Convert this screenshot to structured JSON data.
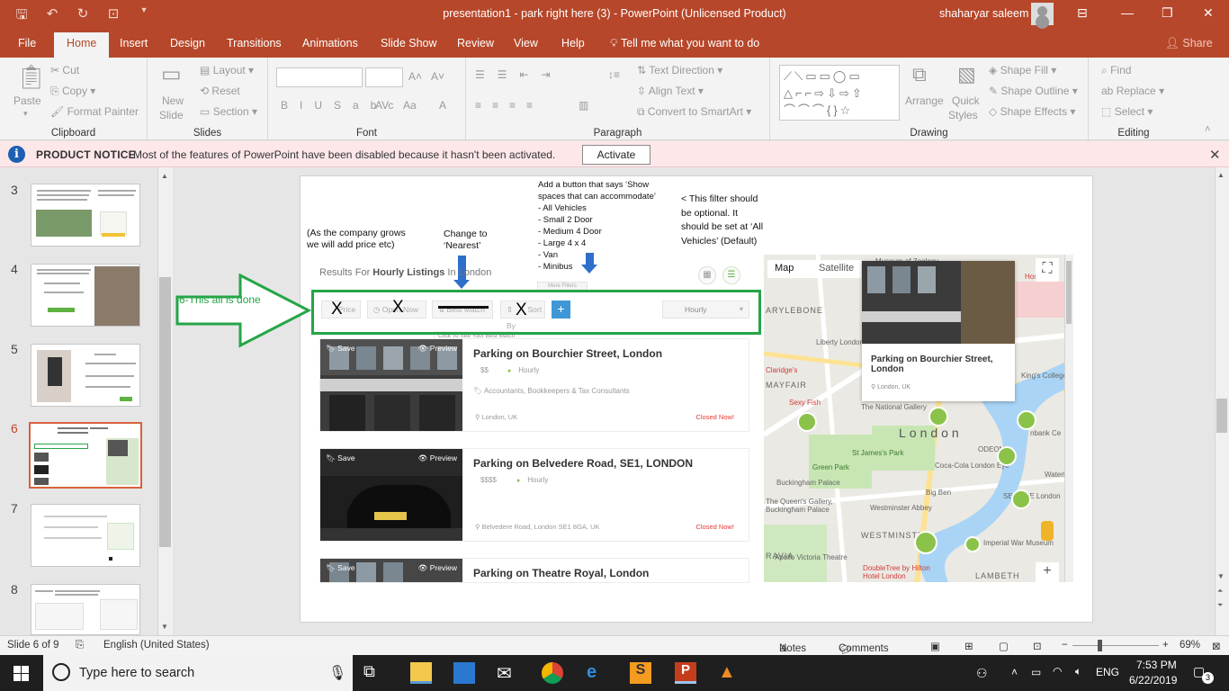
{
  "window": {
    "title": "presentation1 - park right here (3)  -  PowerPoint (Unlicensed Product)",
    "user": "shaharyar saleem"
  },
  "tabs": [
    "File",
    "Home",
    "Insert",
    "Design",
    "Transitions",
    "Animations",
    "Slide Show",
    "Review",
    "View",
    "Help"
  ],
  "tell_me": "Tell me what you want to do",
  "share": "Share",
  "ribbon": {
    "clipboard": {
      "label": "Clipboard",
      "paste": "Paste",
      "cut": "Cut",
      "copy": "Copy",
      "format_painter": "Format Painter"
    },
    "slides": {
      "label": "Slides",
      "new_slide_1": "New",
      "new_slide_2": "Slide",
      "layout": "Layout",
      "reset": "Reset",
      "section": "Section"
    },
    "font": {
      "label": "Font"
    },
    "paragraph": {
      "label": "Paragraph",
      "text_direction": "Text Direction",
      "align_text": "Align Text",
      "convert": "Convert to SmartArt"
    },
    "drawing": {
      "label": "Drawing",
      "arrange": "Arrange",
      "quick_1": "Quick",
      "quick_2": "Styles",
      "fill": "Shape Fill",
      "outline": "Shape Outline",
      "effects": "Shape Effects"
    },
    "editing": {
      "label": "Editing",
      "find": "Find",
      "replace": "Replace",
      "select": "Select"
    }
  },
  "notice": {
    "title": "PRODUCT NOTICE",
    "text": "Most of the features of PowerPoint have been disabled because it hasn't been activated.",
    "button": "Activate"
  },
  "thumbnails": {
    "numbers": [
      "3",
      "4",
      "5",
      "6",
      "7",
      "8"
    ],
    "selected": "6"
  },
  "slide": {
    "note_price": "(As the company grows\nwe will add price etc)",
    "note_nearest": "Change to\n‘Nearest’",
    "note_button": "Add a button that says ‘Show\nspaces that can accommodate’\n- All Vehicles\n- Small 2 Door\n- Medium 4 Door\n- Large 4 x 4\n- Van\n- Minibus",
    "note_optional": "< This filter should\nbe optional. It\nshould be set at ‘All\nVehicles’ (Default)",
    "done_label": "6-This all is done",
    "results_prefix": "Results For ",
    "results_bold": "Hourly Listings",
    "results_suffix": " In London",
    "filters": {
      "price": "Price",
      "open_now": "Open Now",
      "best_match": "Best Match",
      "sort_by": "Sort By",
      "more_filters": "More Filters",
      "match_tip": "Click To See Your Best Match",
      "hourly": "Hourly",
      "x": "X"
    },
    "listings": [
      {
        "title": "Parking on Bourchier Street, London",
        "price": "$$",
        "type": "Hourly",
        "category": "Accountants, Bookkeepers & Tax Consultants",
        "address": "London, UK",
        "status": "Closed Now!"
      },
      {
        "title": "Parking on Belvedere Road, SE1, LONDON",
        "price": "$$$$",
        "type": "Hourly",
        "category": "",
        "address": "Belvedere Road, London SE1 8GA, UK",
        "status": "Closed Now!"
      },
      {
        "title": "Parking on Theatre Royal, London",
        "price": "",
        "type": "",
        "category": "",
        "address": "",
        "status": ""
      }
    ],
    "listing_save": "Save",
    "listing_preview": "Preview",
    "map": {
      "tab_map": "Map",
      "tab_satellite": "Satellite",
      "popup_title": "Parking on Bourchier Street, London",
      "popup_addr": "London, UK",
      "labels": [
        "ARYLEBONE",
        "MAYFAIR",
        "London",
        "WESTMINSTER",
        "LAMBETH",
        "Green Park",
        "St James's Park",
        "Big Ben",
        "Liberty London",
        "King's College London",
        "Coca-Cola London Eye",
        "SEA LIFE London",
        "Imperial War Museum",
        "Westminster Abbey",
        "Buckingham Palace",
        "The Queen's Gallery, Buckingham Palace",
        "Apollo Victoria Theatre",
        "DoubleTree by Hilton Hotel London",
        "Sexy Fish",
        "The National Gallery",
        "Claridge's",
        "ODEON",
        "Waterloo",
        "RAVIA",
        "Museum of Zoology",
        "Hospital",
        "nbank Ce"
      ]
    }
  },
  "status": {
    "slide_of": "Slide 6 of 9",
    "language": "English (United States)",
    "notes": "Notes",
    "comments": "Comments",
    "zoom": "69%"
  },
  "taskbar": {
    "search_placeholder": "Type here to search",
    "lang": "ENG",
    "time": "7:53 PM",
    "date": "6/22/2019",
    "notifications": "3"
  }
}
